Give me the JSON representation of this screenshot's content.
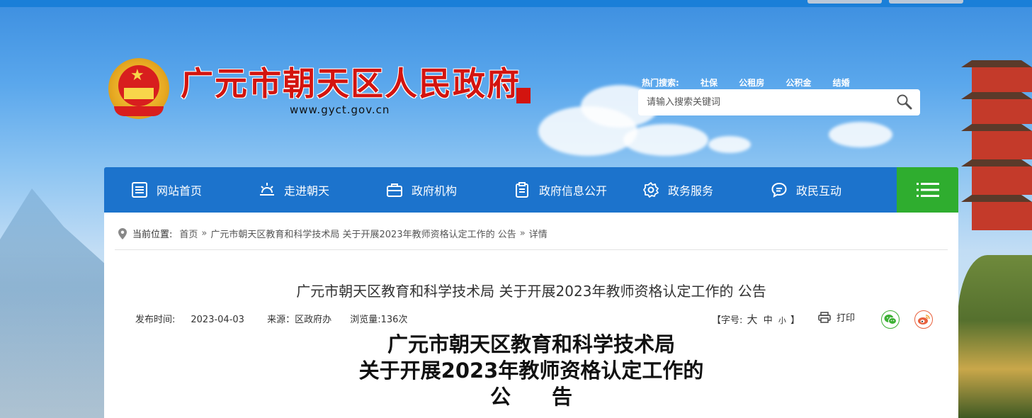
{
  "header": {
    "site_title": "广元市朝天区人民政府",
    "site_url": "www.gyct.gov.cn",
    "seal_text": "中华人民共和国"
  },
  "search": {
    "hot_label": "热门搜索:",
    "hot_terms": [
      "社保",
      "公租房",
      "公积金",
      "结婚"
    ],
    "placeholder": "请输入搜索关键词"
  },
  "nav": {
    "items": [
      {
        "label": "网站首页",
        "icon": "list-icon"
      },
      {
        "label": "走进朝天",
        "icon": "sunrise-icon"
      },
      {
        "label": "政府机构",
        "icon": "briefcase-icon"
      },
      {
        "label": "政府信息公开",
        "icon": "clipboard-icon"
      },
      {
        "label": "政务服务",
        "icon": "gear-icon"
      },
      {
        "label": "政民互动",
        "icon": "chat-icon"
      }
    ],
    "menu_icon": "hamburger-icon"
  },
  "breadcrumb": {
    "label": "当前位置:",
    "items": [
      "首页",
      "广元市朝天区教育和科学技术局 关于开展2023年教师资格认定工作的 公告",
      "详情"
    ],
    "separator": "»"
  },
  "article": {
    "title": "广元市朝天区教育和科学技术局 关于开展2023年教师资格认定工作的 公告",
    "publish_label": "发布时间:",
    "publish_date": "2023-04-03",
    "source": "来源：区政府办",
    "views": "浏览量:136次",
    "font_size_open": "【字号:",
    "font_large": "大",
    "font_medium": "中",
    "font_small": "小",
    "font_size_close": "】",
    "print_label": "打印",
    "body_title_line1": "广元市朝天区教育和科学技术局",
    "body_title_line2": "关于开展2023年教师资格认定工作的",
    "body_title_line3": "公　　告"
  },
  "colors": {
    "nav_bg": "#1c73cc",
    "menu_bg": "#2fad2f",
    "title_red": "#d3140f"
  }
}
